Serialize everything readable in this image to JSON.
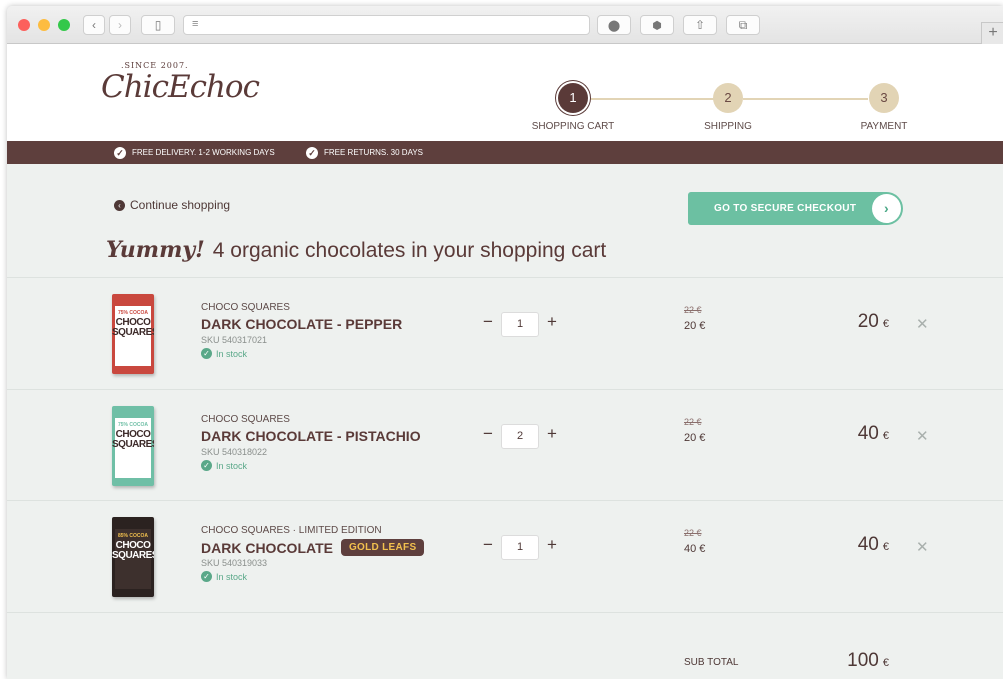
{
  "browser": {
    "new_tab_label": "+"
  },
  "logo": {
    "since": ".SINCE 2007.",
    "name": "ChicEchoc"
  },
  "steps": [
    {
      "number": "1",
      "label": "SHOPPING CART"
    },
    {
      "number": "2",
      "label": "SHIPPING"
    },
    {
      "number": "3",
      "label": "PAYMENT"
    }
  ],
  "promo": [
    "FREE DELIVERY. 1-2 WORKING DAYS",
    "FREE RETURNS. 30 DAYS"
  ],
  "continue_label": "Continue shopping",
  "checkout_label": "GO TO SECURE CHECKOUT",
  "heading": {
    "yummy": "Yummy!",
    "text": "4 organic chocolates in your shopping cart"
  },
  "items": [
    {
      "category": "CHOCO SQUARES",
      "edition": "",
      "name": "DARK CHOCOLATE - PEPPER",
      "badge": "",
      "sku": "SKU 540317021",
      "stock": "In stock",
      "qty": "1",
      "old_price": "22 €",
      "unit_price": "20 €",
      "total": "20",
      "currency": "€",
      "pack": {
        "cocoa": "75% COCOA",
        "brand": "CHOCO SQUARES",
        "color": "#c9483e"
      }
    },
    {
      "category": "CHOCO SQUARES",
      "edition": "",
      "name": "DARK CHOCOLATE - PISTACHIO",
      "badge": "",
      "sku": "SKU 540318022",
      "stock": "In stock",
      "qty": "2",
      "old_price": "22 €",
      "unit_price": "20 €",
      "total": "40",
      "currency": "€",
      "pack": {
        "cocoa": "75% COCOA",
        "brand": "CHOCO SQUARES",
        "color": "#6fbfa6"
      }
    },
    {
      "category": "CHOCO SQUARES",
      "edition": " · LIMITED EDITION",
      "name": "DARK CHOCOLATE",
      "badge": "GOLD LEAFS",
      "sku": "SKU 540319033",
      "stock": "In stock",
      "qty": "1",
      "old_price": "22 €",
      "unit_price": "40 €",
      "total": "40",
      "currency": "€",
      "pack": {
        "cocoa": "85% COCOA",
        "brand": "CHOCO SQUARES",
        "color": "#2b2220"
      }
    }
  ],
  "subtotal": {
    "label": "SUB TOTAL",
    "value": "100",
    "currency": "€"
  },
  "colors": {
    "brand_brown": "#5a3a38",
    "accent_green": "#6cc0a2",
    "step_tan": "#e2d4b5",
    "badge_gold": "#f2c14e"
  }
}
